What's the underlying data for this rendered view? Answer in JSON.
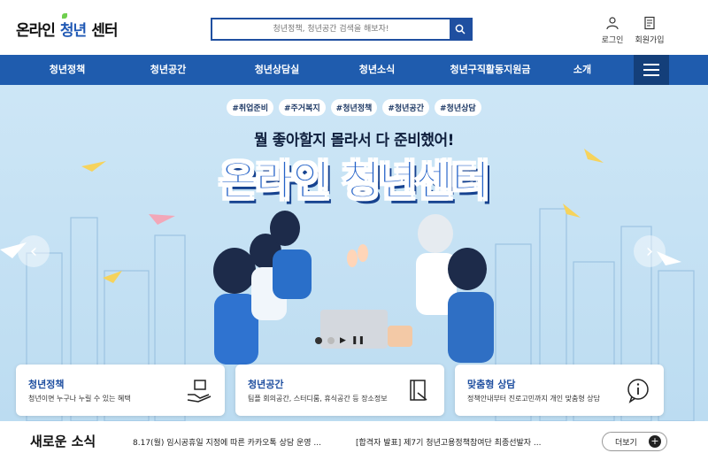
{
  "header": {
    "logo": {
      "part1": "온라인",
      "part2": "청년",
      "part3": "센터"
    },
    "search": {
      "placeholder": "청년정책, 청년공간 검색을 해보자!"
    },
    "login_label": "로그인",
    "join_label": "회원가입"
  },
  "nav": {
    "items": [
      "청년정책",
      "청년공간",
      "청년상담실",
      "청년소식",
      "청년구직활동지원금",
      "소개"
    ]
  },
  "hero": {
    "tags": [
      "#취업준비",
      "#주거복지",
      "#청년정책",
      "#청년공간",
      "#청년상담"
    ],
    "subtitle": "뭘 좋아할지 몰라서 다 준비했어!",
    "title": "온라인 청년센터"
  },
  "cards": [
    {
      "title": "청년정책",
      "desc": "청년이면 누구나 누릴 수 있는 혜택"
    },
    {
      "title": "청년공간",
      "desc": "팀플 회의공간, 스터디룸, 휴식공간 등 장소정보"
    },
    {
      "title": "맞춤형 상담",
      "desc": "정책안내부터 진로고민까지 개인 맞춤형 상담"
    }
  ],
  "news": {
    "title": "새로운 소식",
    "items": [
      "8.17(월) 임시공휴일 지정에 따른 카카오톡 상담 운영 ...",
      "[합격자 발표] 제7기 청년고용정책참여단 최종선발자 ..."
    ],
    "more_label": "더보기"
  },
  "colors": {
    "primary": "#1f5cae",
    "dark": "#143f7a",
    "accent": "#2462c8"
  }
}
